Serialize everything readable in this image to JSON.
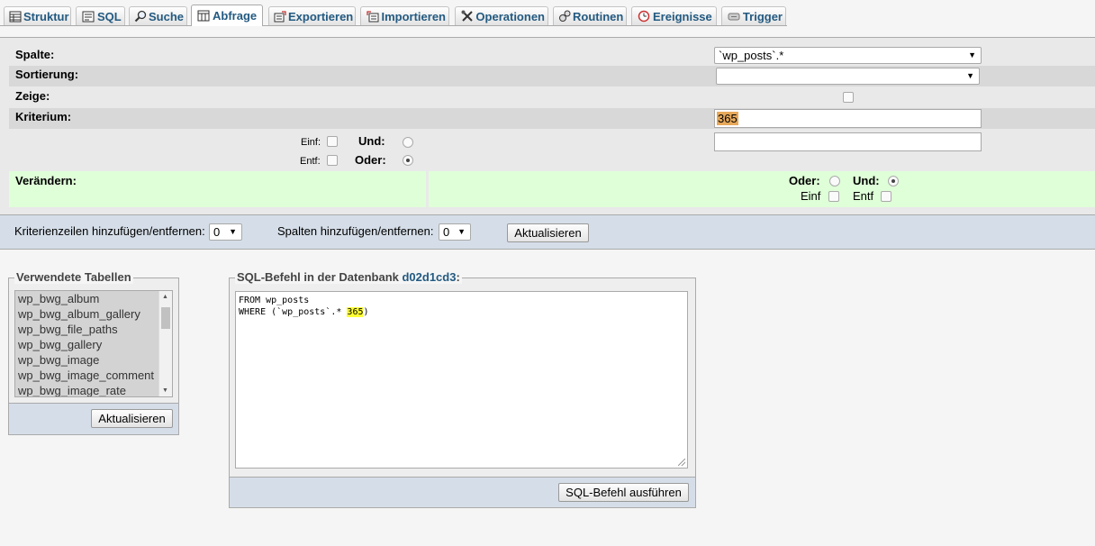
{
  "tabs": [
    {
      "label": "Struktur",
      "icon": "structure-icon",
      "active": false
    },
    {
      "label": "SQL",
      "icon": "sql-icon",
      "active": false
    },
    {
      "label": "Suche",
      "icon": "search-icon",
      "active": false
    },
    {
      "label": "Abfrage",
      "icon": "query-icon",
      "active": true
    },
    {
      "label": "Exportieren",
      "icon": "export-icon",
      "active": false
    },
    {
      "label": "Importieren",
      "icon": "import-icon",
      "active": false
    },
    {
      "label": "Operationen",
      "icon": "tools-icon",
      "active": false
    },
    {
      "label": "Routinen",
      "icon": "routines-icon",
      "active": false
    },
    {
      "label": "Ereignisse",
      "icon": "clock-icon",
      "active": false
    },
    {
      "label": "Trigger",
      "icon": "trigger-icon",
      "active": false
    }
  ],
  "query": {
    "spalte_label": "Spalte:",
    "spalte_value": "`wp_posts`.*",
    "sortierung_label": "Sortierung:",
    "sortierung_value": "",
    "zeige_label": "Zeige:",
    "zeige_checked": false,
    "kriterium_label": "Kriterium:",
    "kriterium_value": "365",
    "kriterium2_value": "",
    "einf_label": "Einf:",
    "entf_label": "Entf:",
    "und_label": "Und:",
    "oder_label": "Oder:",
    "row_logic_selected": "Oder",
    "veraendern_label": "Verändern:",
    "col_oder_label": "Oder:",
    "col_und_label": "Und:",
    "col_logic_selected": "Und",
    "col_einf_label": "Einf",
    "col_entf_label": "Entf"
  },
  "footer": {
    "criteria_rows_label": "Kriterienzeilen hinzufügen/entfernen:",
    "criteria_rows_value": "0",
    "columns_label": "Spalten hinzufügen/entfernen:",
    "columns_value": "0",
    "update_button": "Aktualisieren"
  },
  "tables_fieldset": {
    "legend": "Verwendete Tabellen",
    "items": [
      "wp_bwg_album",
      "wp_bwg_album_gallery",
      "wp_bwg_file_paths",
      "wp_bwg_gallery",
      "wp_bwg_image",
      "wp_bwg_image_comment",
      "wp_bwg_image_rate"
    ],
    "update_button": "Aktualisieren"
  },
  "sql_fieldset": {
    "legend_prefix": "SQL-Befehl in der Datenbank ",
    "database": "d02d1cd3",
    "legend_suffix": ":",
    "line1": "FROM wp_posts",
    "line2_prefix": "WHERE (`wp_posts`.* ",
    "line2_value": "365",
    "line2_suffix": ")",
    "execute_button": "SQL-Befehl ausführen"
  }
}
